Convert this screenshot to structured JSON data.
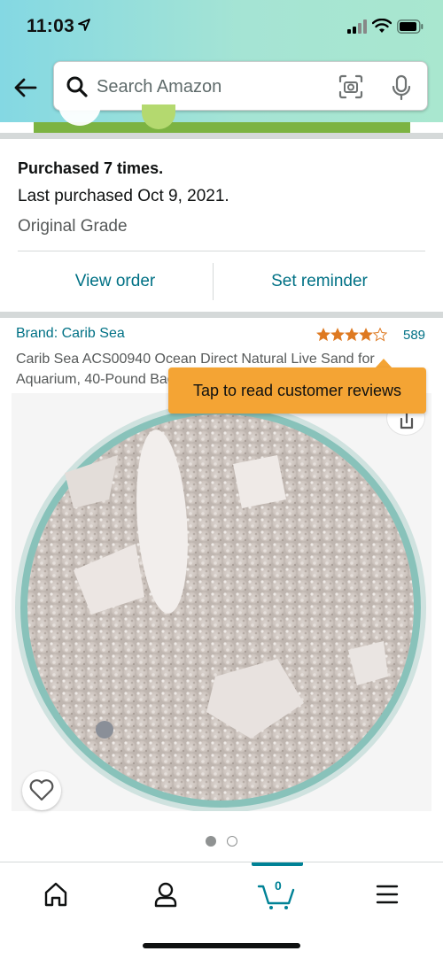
{
  "status_bar": {
    "time": "11:03"
  },
  "header": {
    "search": {
      "placeholder": "Search Amazon"
    }
  },
  "purchase_info": {
    "purchased_count": "Purchased 7 times.",
    "last_purchased": "Last purchased Oct 9, 2021.",
    "grade": "Original Grade",
    "view_order_label": "View order",
    "set_reminder_label": "Set reminder"
  },
  "product": {
    "brand": "Brand: Carib Sea",
    "rating": 4.5,
    "review_count": "589",
    "title": "Carib Sea ACS00940 Ocean Direct Natural Live Sand for Aquarium, 40-Pound Bag",
    "image_carousel": {
      "current": 1,
      "total": 2
    }
  },
  "tooltip": {
    "text": "Tap to read customer reviews"
  },
  "bottom_nav": {
    "items": [
      {
        "name": "home",
        "icon": "home-icon"
      },
      {
        "name": "account",
        "icon": "person-icon"
      },
      {
        "name": "cart",
        "icon": "cart-icon",
        "count": "0"
      },
      {
        "name": "menu",
        "icon": "menu-icon"
      }
    ]
  },
  "colors": {
    "link": "#007185",
    "tooltip": "#f4a434",
    "cart_accent": "#008296",
    "header_gradient_start": "#84d8e3",
    "header_gradient_end": "#a9e7cf"
  }
}
